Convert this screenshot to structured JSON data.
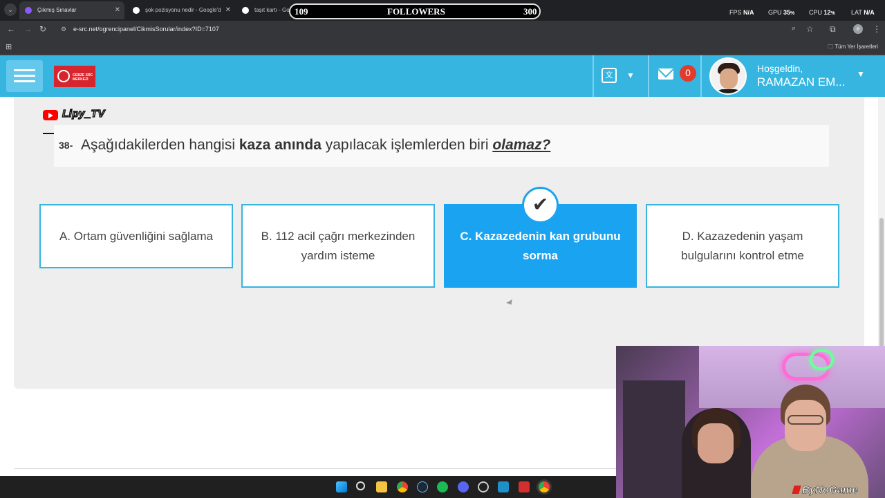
{
  "browser": {
    "tabs": [
      {
        "title": "Çıkmış Sınavlar",
        "active": true
      },
      {
        "title": "şok pozisyonu nedir - Google'd",
        "active": false
      },
      {
        "title": "taşıt kartı - Go",
        "active": false
      }
    ],
    "url": "e-src.net/ogrencipanel/CikmisSorular/index?ID=7107",
    "bookmarks_label": "Tüm Yer İşaretleri",
    "profile_initial": "e"
  },
  "overlay": {
    "followers_current": "109",
    "followers_label": "FOLLOWERS",
    "followers_goal": "300",
    "fps_label": "FPS",
    "fps_value": "N/A",
    "gpu_label": "GPU",
    "gpu_value": "35",
    "cpu_label": "CPU",
    "cpu_value": "12",
    "lat_label": "LAT",
    "lat_value": "N/A",
    "percent": "%"
  },
  "site": {
    "logo_text": "GEBZE SRC MERKEZİ",
    "notification_count": "0",
    "greeting": "Hoşgeldin,",
    "user_name": "RAMAZAN EM..."
  },
  "watermark": "Lipy_TV",
  "question": {
    "number": "38-",
    "text_part1": "Aşağıdakilerden hangisi ",
    "text_bold": "kaza anında",
    "text_part2": " yapılacak işlemlerden biri ",
    "text_emphasis": "olamaz?"
  },
  "answers": [
    {
      "label": "A. Ortam güvenliğini sağlama",
      "correct": false
    },
    {
      "label": "B. 112 acil çağrı merkezinden yardım isteme",
      "correct": false
    },
    {
      "label": "C. Kazazedenin kan grubunu sorma",
      "correct": true
    },
    {
      "label": "D. Kazazedenin yaşam bulgularını kontrol etme",
      "correct": false
    }
  ],
  "webcam": {
    "brand": "ByNoGame"
  },
  "colors": {
    "accent": "#35b5e0",
    "correct": "#1aa3f0",
    "badge": "#e23b2e"
  }
}
